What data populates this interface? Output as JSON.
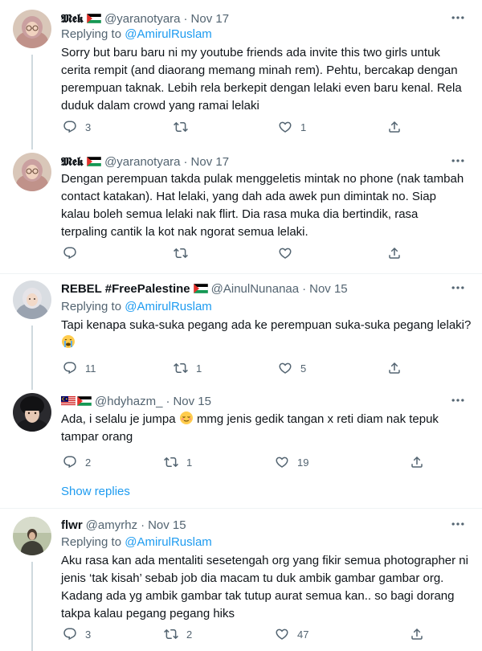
{
  "tweets": [
    {
      "name": "𝕸𝖊𝖐",
      "handle": "@yaranotyara",
      "dot": "·",
      "date": "Nov 17",
      "replying_prefix": "Replying to",
      "replying_to": "@AmirulRuslam",
      "lines": [
        "Sorry but baru baru ni my youtube friends ada invite this two girls untuk",
        "cerita rempit (and diaorang memang minah rem). Pehtu, bercakap dengan",
        "perempuan taknak. Lebih rela berkepit dengan lelaki even baru kenal. Rela",
        "duduk dalam crowd yang ramai lelaki"
      ],
      "reply_count": "3",
      "retweet_count": "",
      "like_count": "1"
    },
    {
      "name": "𝕸𝖊𝖐",
      "handle": "@yaranotyara",
      "dot": "·",
      "date": "Nov 17",
      "lines": [
        "Dengan perempuan takda pulak menggeletis mintak no phone (nak tambah",
        "contact katakan). Hat lelaki, yang dah ada awek pun dimintak no. Siap",
        "kalau boleh semua lelaki nak flirt. Dia rasa muka dia bertindik, rasa",
        "terpaling cantik la kot nak ngorat semua lelaki."
      ],
      "reply_count": "",
      "retweet_count": "",
      "like_count": ""
    },
    {
      "name": "REBEL #FreePalestine",
      "handle": "@AinulNunanaa",
      "dot": "·",
      "date": "Nov 15",
      "replying_prefix": "Replying to",
      "replying_to": "@AmirulRuslam",
      "lines": [
        "Tapi kenapa suka-suka pegang ada ke perempuan suka-suka pegang lelaki?"
      ],
      "reply_count": "11",
      "retweet_count": "1",
      "like_count": "5"
    },
    {
      "name": "",
      "handle": "@hdyhazm_",
      "dot": "·",
      "date": "Nov 15",
      "lines": [
        "Ada, i selalu je jumpa",
        "tampar orang"
      ],
      "line1_suffix": "mmg jenis gedik tangan x reti diam nak tepuk",
      "reply_count": "2",
      "retweet_count": "1",
      "like_count": "19"
    },
    {
      "name": "flwr",
      "handle": "@amyrhz",
      "dot": "·",
      "date": "Nov 15",
      "replying_prefix": "Replying to",
      "replying_to": "@AmirulRuslam",
      "lines": [
        "Aku rasa kan ada mentaliti sesetengah org yang fikir semua photographer ni",
        "jenis ‘tak kisah’ sebab job dia macam tu duk ambik gambar gambar org.",
        "Kadang ada yg ambik gambar tak tutup aurat semua kan.. so bagi dorang",
        "takpa kalau pegang pegang hiks"
      ],
      "reply_count": "3",
      "retweet_count": "2",
      "like_count": "47"
    }
  ],
  "show_replies": "Show replies",
  "colors": {
    "link": "#1d9bf0",
    "secondary": "#536471",
    "separator": "#eff3f4",
    "thread_line": "#cfd9de"
  },
  "icons": {
    "reply": "reply-icon",
    "retweet": "retweet-icon",
    "like": "heart-icon",
    "share": "share-icon",
    "more": "more-icon"
  }
}
